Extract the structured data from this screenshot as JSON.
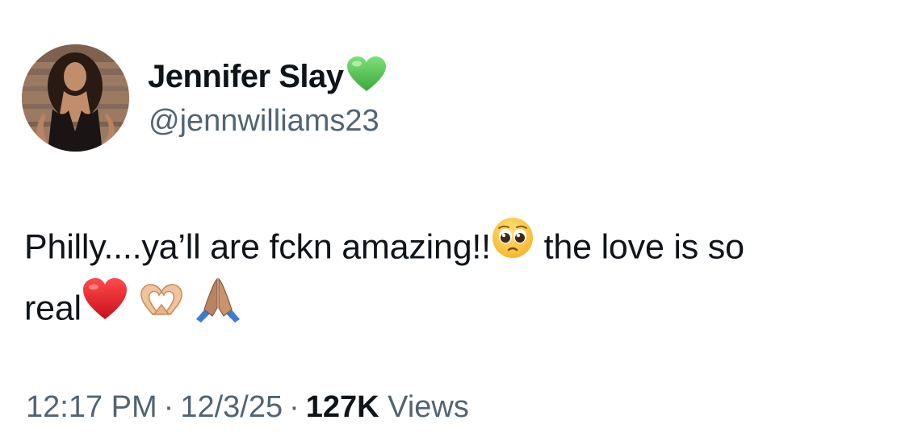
{
  "author": {
    "display_name": "Jennifer Slay",
    "verified_icon": "green-heart-icon",
    "handle": "@jennwilliams23"
  },
  "post": {
    "text_line1_a": "Philly....ya’ll are fckn amazing!!",
    "emoji_1": "pleading-face-icon",
    "text_line1_b": " the love is so",
    "text_line2": "real",
    "emoji_2": "red-heart-icon",
    "emoji_3": "heart-hands-icon",
    "emoji_4": "folded-hands-icon"
  },
  "meta": {
    "time": "12:17 PM",
    "dot": "·",
    "date": "12/3/25",
    "views_count": "127K",
    "views_label": "Views"
  },
  "colors": {
    "text_primary": "#0f1419",
    "text_secondary": "#536471",
    "green_heart": "#4bc44b",
    "red_heart": "#e0202a"
  }
}
